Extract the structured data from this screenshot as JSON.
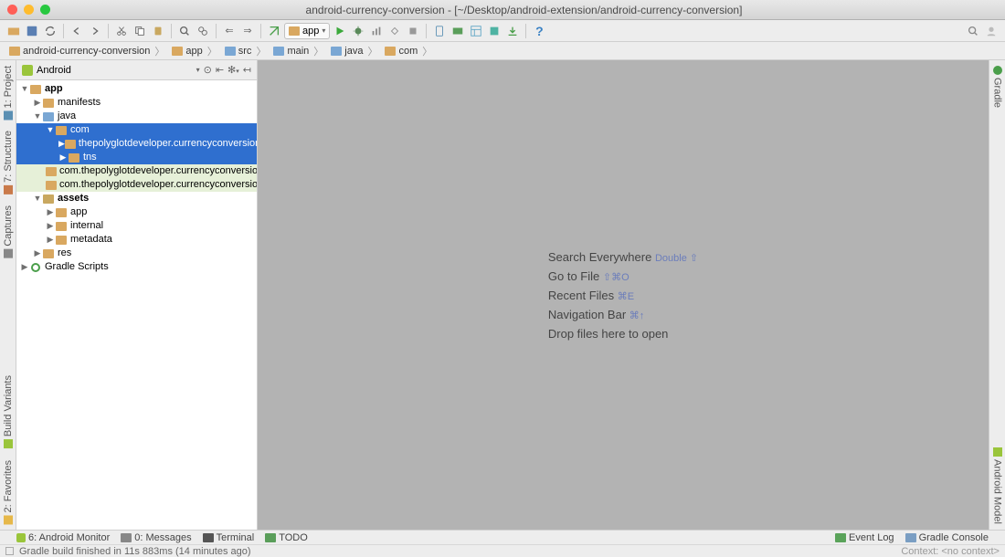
{
  "window": {
    "title": "android-currency-conversion - [~/Desktop/android-extension/android-currency-conversion]"
  },
  "toolbar": {
    "run_config": "app"
  },
  "breadcrumb": [
    {
      "label": "android-currency-conversion",
      "icon": "folder-tan"
    },
    {
      "label": "app",
      "icon": "folder-tan"
    },
    {
      "label": "src",
      "icon": "folder-blue"
    },
    {
      "label": "main",
      "icon": "folder-blue"
    },
    {
      "label": "java",
      "icon": "folder-blue"
    },
    {
      "label": "com",
      "icon": "folder-tan"
    }
  ],
  "sidebar": {
    "view": "Android",
    "nodes": [
      {
        "d": 1,
        "exp": "down",
        "icon": "folder-y",
        "label": "app",
        "bold": true
      },
      {
        "d": 2,
        "exp": "right",
        "icon": "folder-y",
        "label": "manifests"
      },
      {
        "d": 2,
        "exp": "down",
        "icon": "folder-b",
        "label": "java"
      },
      {
        "d": 3,
        "exp": "down",
        "icon": "folder-y",
        "label": "com",
        "sel": true
      },
      {
        "d": 4,
        "exp": "right",
        "icon": "folder-y",
        "label": "thepolyglotdeveloper.currencyconversion",
        "sel": true
      },
      {
        "d": 4,
        "exp": "right",
        "icon": "folder-y",
        "label": "tns",
        "sel": true
      },
      {
        "d": 3,
        "exp": "",
        "icon": "folder-y",
        "label": "com.thepolyglotdeveloper.currencyconversion",
        "shade": true
      },
      {
        "d": 3,
        "exp": "",
        "icon": "folder-y",
        "label": "com.thepolyglotdeveloper.currencyconversion",
        "shade": true
      },
      {
        "d": 2,
        "exp": "down",
        "icon": "folder-s",
        "label": "assets",
        "bold": true
      },
      {
        "d": 3,
        "exp": "right",
        "icon": "folder-y",
        "label": "app"
      },
      {
        "d": 3,
        "exp": "right",
        "icon": "folder-y",
        "label": "internal"
      },
      {
        "d": 3,
        "exp": "right",
        "icon": "folder-y",
        "label": "metadata"
      },
      {
        "d": 2,
        "exp": "right",
        "icon": "folder-y",
        "label": "res"
      },
      {
        "d": 1,
        "exp": "right",
        "icon": "gradle",
        "label": "Gradle Scripts"
      }
    ]
  },
  "welcome": [
    {
      "text": "Search Everywhere ",
      "kb": "Double ⇧"
    },
    {
      "text": "Go to File ",
      "kb": "⇧⌘O"
    },
    {
      "text": "Recent Files ",
      "kb": "⌘E"
    },
    {
      "text": "Navigation Bar ",
      "kb": "⌘↑"
    },
    {
      "text": "Drop files here to open",
      "kb": ""
    }
  ],
  "left_tabs": {
    "project": "1: Project",
    "structure": "7: Structure",
    "captures": "Captures",
    "build": "Build Variants",
    "fav": "2: Favorites"
  },
  "right_tabs": {
    "gradle": "Gradle",
    "model": "Android Model"
  },
  "bottom": {
    "monitor": "6: Android Monitor",
    "messages": "0: Messages",
    "terminal": "Terminal",
    "todo": "TODO",
    "eventlog": "Event Log",
    "console": "Gradle Console"
  },
  "status": {
    "msg": "Gradle build finished in 11s 883ms (14 minutes ago)",
    "context": "Context: <no context>"
  }
}
